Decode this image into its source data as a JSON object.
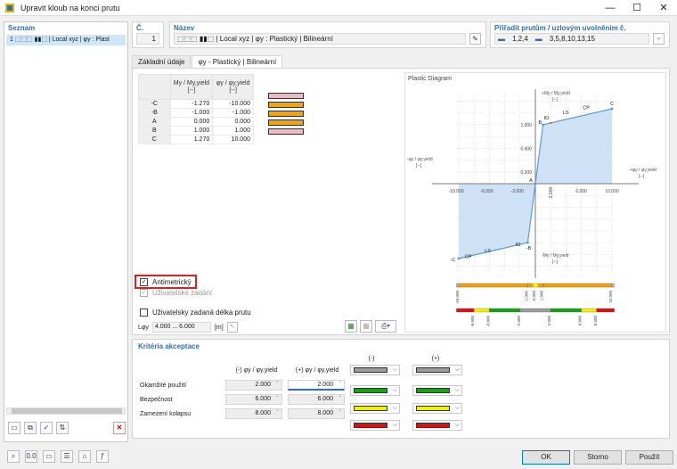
{
  "window": {
    "title": "Upravit kloub na konci prutu",
    "minimize": "—",
    "maximize": "☐",
    "close": "✕"
  },
  "left_panel": {
    "header": "Seznam",
    "item": "1 ⬚⬚⬚ ▮▮⬚ | Local xyz | φy : Plast"
  },
  "number": {
    "label": "Č.",
    "value": "1"
  },
  "name": {
    "label": "Název",
    "value": "⬚⬚⬚ ▮▮⬚ | Local xyz | φy : Plastický | Bilineární"
  },
  "assign": {
    "label": "Přiřadit prutům / uzlovým uvolněním č.",
    "members": "1,2,4",
    "nodes": "3,5,8,10,13,15"
  },
  "tabs": [
    "Základní údaje",
    "φy - Plastický | Bilineární"
  ],
  "table": {
    "col1_header_line1": "My / My,yield",
    "col1_header_line2": "[--]",
    "col2_header_line1": "φy / φy,yield",
    "col2_header_line2": "[--]",
    "rows": [
      {
        "key": "-C",
        "m": "-1.270",
        "phi": "-10.000",
        "color": "#f4b6c2"
      },
      {
        "key": "-B",
        "m": "-1.000",
        "phi": "-1.000",
        "color": "#f5a300"
      },
      {
        "key": "A",
        "m": "0.000",
        "phi": "0.000",
        "color": "#f5a300"
      },
      {
        "key": "B",
        "m": "1.000",
        "phi": "1.000",
        "color": "#f5a300"
      },
      {
        "key": "C",
        "m": "1.270",
        "phi": "10.000",
        "color": "#f4b6c2"
      }
    ]
  },
  "checkboxes": {
    "antimetric": "Antimetrický",
    "user_defined": "Uživatelské zadání",
    "user_length": "Uživatelsky zadaná délka prutu"
  },
  "length": {
    "label": "Lφy",
    "value": "4.000 ... 6.000",
    "unit": "[m]"
  },
  "diagram": {
    "title": "Plastic Diagram",
    "y_axis_label": "+My / My,yield",
    "y_axis_unit": "[--]",
    "y_axis_neg_label": "-My / My,yield",
    "x_axis_label": "+φy / φy,yield",
    "x_axis_neg_label": "-φy / φy,yield",
    "unit": "[--]",
    "x_ticks": [
      "-10.000",
      "-6.000",
      "-2.000",
      "2.000",
      "6.000",
      "10.000"
    ],
    "y_ticks": [
      "1.000",
      "0.600",
      "0.200"
    ],
    "point_labels": [
      "C",
      "CP",
      "LS",
      "IO",
      "B",
      "A",
      "-B",
      "IO",
      "LS",
      "CP",
      "-C"
    ],
    "bar1_labels": [
      "-10.000",
      "-1.000",
      "0.000",
      "1.000",
      "10.000"
    ],
    "bar2_labels": [
      "-8.000",
      "-6.000",
      "-2.000",
      "2.000",
      "6.000",
      "8.000"
    ]
  },
  "chart_data": {
    "type": "line",
    "title": "Plastic Diagram",
    "xlabel": "φy / φy,yield",
    "ylabel": "My / My,yield",
    "x": [
      -10.0,
      -1.0,
      0.0,
      1.0,
      10.0
    ],
    "series": [
      {
        "values": [
          -1.27,
          -1.0,
          0.0,
          1.0,
          1.27
        ]
      }
    ],
    "xlim": [
      -10,
      10
    ],
    "ylim": [
      -1.27,
      1.27
    ]
  },
  "criteria": {
    "title": "Kritéria akceptace",
    "col_neg_header": "(-) φy / φy,yield",
    "col_pos_header": "(+) φy / φy,yield",
    "color_neg_header": "(-)",
    "color_pos_header": "(+)",
    "rows": [
      {
        "label": "Okamžité použití",
        "neg": "2.000",
        "pos": "2.000",
        "color": "#9b9b9b"
      },
      {
        "label": "Bezpečnost",
        "neg": "6.000",
        "pos": "6.000",
        "color": "#14a314"
      },
      {
        "label": "Zamezení kolapsu",
        "neg": "8.000",
        "pos": "8.000",
        "color": "#f2f200"
      },
      {
        "label": "",
        "neg": "",
        "pos": "",
        "color": "#e01010"
      }
    ]
  },
  "buttons": {
    "ok": "OK",
    "cancel": "Storno",
    "apply": "Použít"
  }
}
